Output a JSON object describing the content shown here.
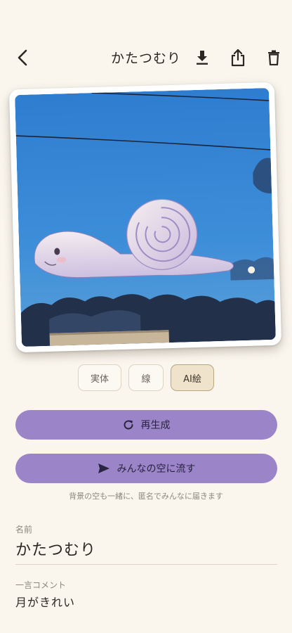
{
  "header": {
    "title": "かたつむり",
    "back_icon": "chevron-left-icon",
    "download_icon": "download-icon",
    "share_icon": "share-icon",
    "delete_icon": "trash-icon"
  },
  "photo": {
    "description_icon": "snail-cloud-illustration"
  },
  "modes": [
    {
      "label": "実体",
      "active": false
    },
    {
      "label": "線",
      "active": false
    },
    {
      "label": "AI絵",
      "active": true
    }
  ],
  "actions": {
    "regenerate_label": "再生成",
    "regenerate_icon": "refresh-icon",
    "send_label": "みんなの空に流す",
    "send_icon": "send-icon",
    "send_caption": "背景の空も一緒に、匿名でみんなに届きます"
  },
  "fields": {
    "name_label": "名前",
    "name_value": "かたつむり",
    "comment_label": "一言コメント",
    "comment_value": "月がきれい"
  },
  "colors": {
    "background": "#faf6ee",
    "accent_purple": "#9b85c8",
    "active_mode": "#efe3cb",
    "sky_blue": "#3a86d4"
  }
}
